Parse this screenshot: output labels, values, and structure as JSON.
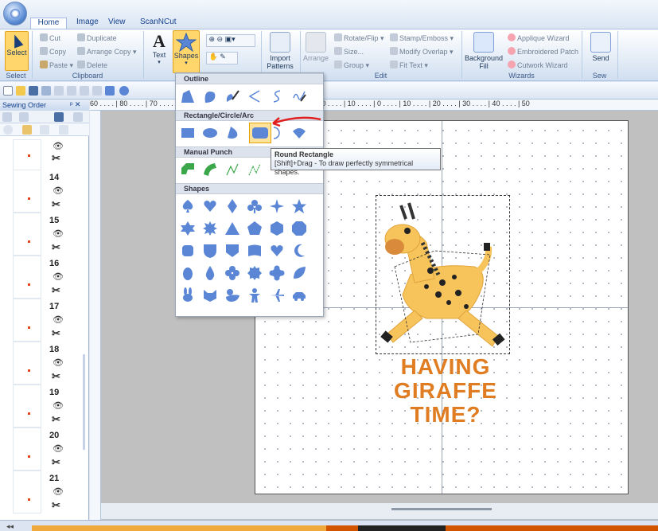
{
  "tabs": [
    "Home",
    "Image",
    "View",
    "ScanNCut"
  ],
  "ribbon": {
    "select": "Select",
    "cut": "Cut",
    "copy": "Copy",
    "paste": "Paste",
    "duplicate": "Duplicate",
    "arrange_copy": "Arrange Copy",
    "delete": "Delete",
    "text": "Text",
    "shapes": "Shapes",
    "import_patterns": "Import Patterns",
    "arrange": "Arrange",
    "rotate_flip": "Rotate/Flip",
    "stamp_emboss": "Stamp/Emboss",
    "size": "Size...",
    "modify_overlap": "Modify Overlap",
    "group": "Group",
    "fit_text": "Fit Text",
    "background_fill": "Background Fill",
    "applique_wizard": "Applique Wizard",
    "embroidered_patch": "Embroidered Patch",
    "cutwork_wizard": "Cutwork Wizard",
    "send": "Send",
    "groups": {
      "select": "Select",
      "clipboard": "Clipboard",
      "edit": "Edit",
      "wizards": "Wizards",
      "sew": "Sew"
    }
  },
  "sewing_order": {
    "title": "Sewing Order",
    "items": [
      {
        "num": ""
      },
      {
        "num": "14"
      },
      {
        "num": "15"
      },
      {
        "num": "16"
      },
      {
        "num": "17"
      },
      {
        "num": "18"
      },
      {
        "num": "19"
      },
      {
        "num": "20"
      },
      {
        "num": "21"
      }
    ]
  },
  "ruler_top": "60 . . . . | 80 . . . . | 70 . . . . | . . . . | 60 . . . . | 50 . . . . | 40 . . . . | 30 . . . . | 20 . . . . | 10 . . . . | 0 . . . . | 10 . . . . | 20 . . . . | 30 . . . . | 40 . . . . | 50",
  "shapes_menu": {
    "sections": [
      "Outline",
      "Rectangle/Circle/Arc",
      "Manual Punch",
      "Shapes"
    ]
  },
  "tooltip": {
    "title": "Round Rectangle",
    "text": "[Shift]+Drag - To draw perfectly symmetrical shapes."
  },
  "design_text": [
    "HAVING",
    "GIRAFFE",
    "TIME?"
  ]
}
